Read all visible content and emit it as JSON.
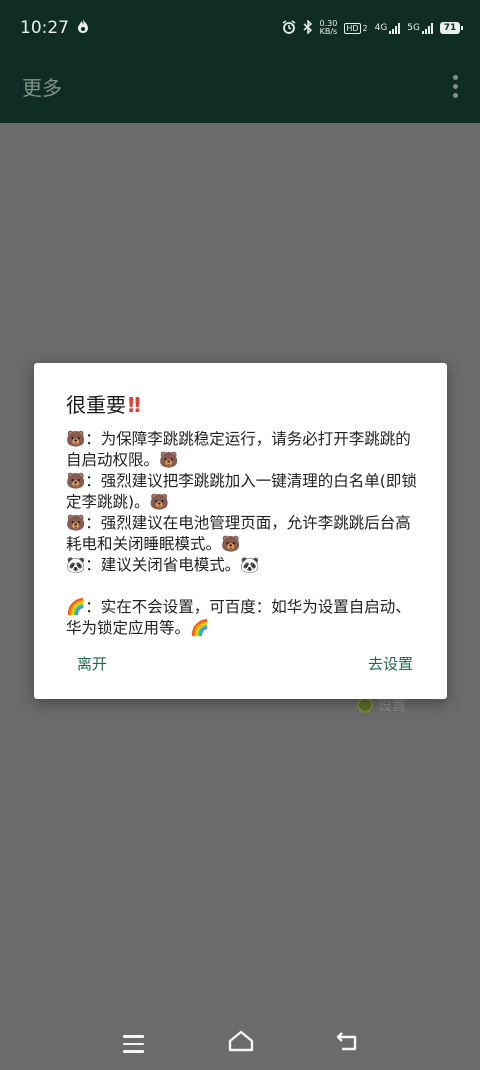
{
  "status_bar": {
    "time": "10:27",
    "net_speed": "0.30",
    "net_unit": "KB/s",
    "hd": "HD",
    "hd_sub": "2",
    "sig1_label": "4G",
    "sig2_label": "5G",
    "battery": "71"
  },
  "app_bar": {
    "title": "更多"
  },
  "background": {
    "setting_label": "设置"
  },
  "dialog": {
    "title": "很重要",
    "title_mark": "‼",
    "lines": [
      "🐻：为保障李跳跳稳定运行，请务必打开李跳跳的自启动权限。🐻",
      "🐻：强烈建议把李跳跳加入一键清理的白名单(即锁定李跳跳)。🐻",
      "🐻：强烈建议在电池管理页面，允许李跳跳后台高耗电和关闭睡眠模式。🐻",
      "🐼：建议关闭省电模式。🐼",
      "🌈：实在不会设置，可百度：如华为设置自启动、华为锁定应用等。🌈"
    ],
    "leave_button": "离开",
    "go_settings_button": "去设置"
  },
  "colors": {
    "topbar_bg": "#0f2d24",
    "scrim_bg": "#6b6b6b",
    "accent": "#1c6b4f",
    "title_mark": "#e53935"
  },
  "icons": {
    "status_flame": "flame-icon",
    "alarm": "alarm-icon",
    "bluetooth": "bluetooth-icon",
    "overflow": "more-vert-icon",
    "nav_menu": "menu-icon",
    "nav_home": "home-icon",
    "nav_back": "back-icon"
  }
}
